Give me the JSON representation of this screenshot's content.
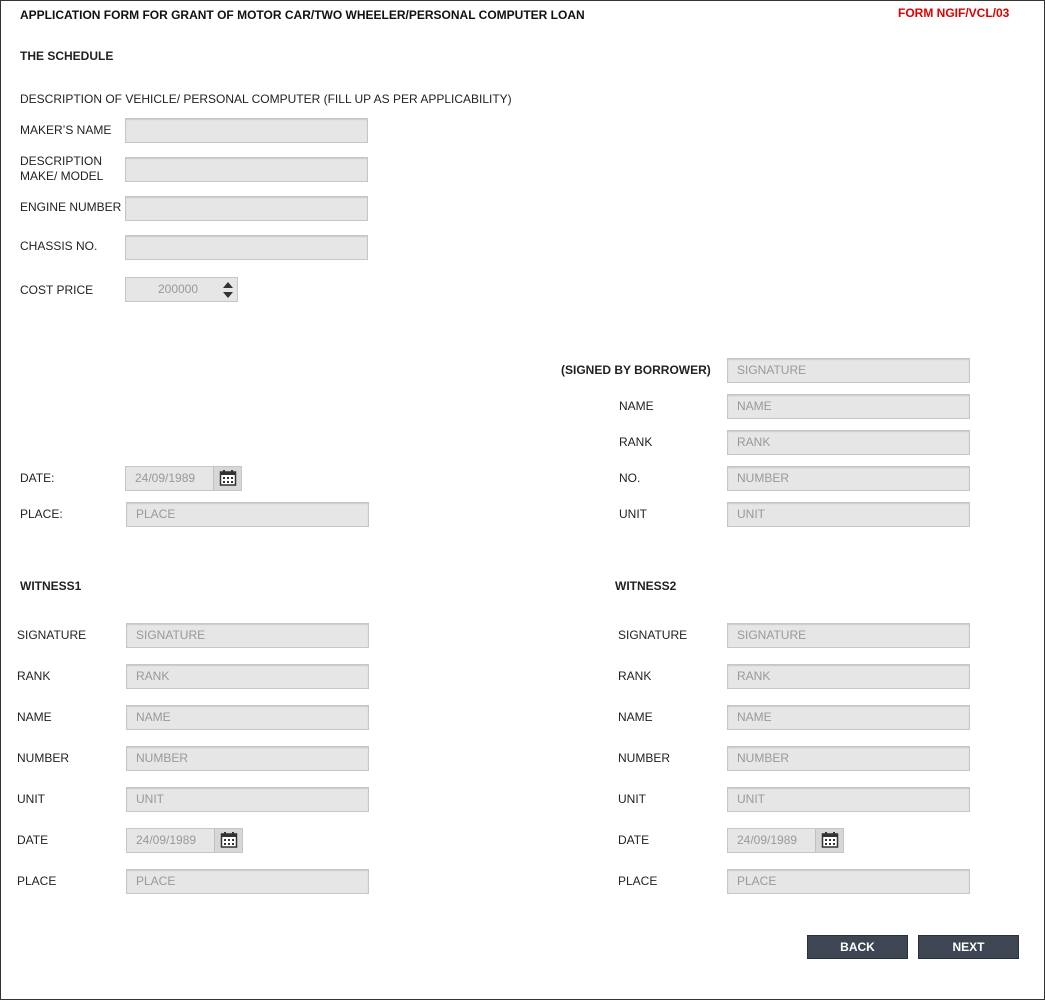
{
  "header": {
    "title": "APPLICATION FORM FOR GRANT OF MOTOR CAR/TWO WHEELER/PERSONAL COMPUTER LOAN",
    "form_code": "FORM NGIF/VCL/03"
  },
  "schedule": {
    "heading": "THE SCHEDULE",
    "description": "DESCRIPTION OF VEHICLE/ PERSONAL COMPUTER (FILL UP AS PER APPLICABILITY)",
    "maker_label": "MAKER’S NAME",
    "maker_value": "",
    "description_label_line1": "DESCRIPTION",
    "description_label_line2": "MAKE/ MODEL",
    "description_value": "",
    "engine_label": "ENGINE NUMBER",
    "engine_value": "",
    "chassis_label": "CHASSIS NO.",
    "chassis_value": "",
    "cost_label": "COST PRICE",
    "cost_value": "200000"
  },
  "borrower": {
    "signed_label": "(SIGNED BY BORROWER)",
    "signature_placeholder": "SIGNATURE",
    "name_label": "NAME",
    "name_placeholder": "NAME",
    "rank_label": "RANK",
    "rank_placeholder": "RANK",
    "no_label": "NO.",
    "no_placeholder": "NUMBER",
    "unit_label": "UNIT",
    "unit_placeholder": "UNIT",
    "date_label": "DATE:",
    "date_value": "24/09/1989",
    "place_label": "PLACE:",
    "place_placeholder": "PLACE"
  },
  "witness1": {
    "heading": "WITNESS1",
    "signature_label": "SIGNATURE",
    "signature_placeholder": "SIGNATURE",
    "rank_label": "RANK",
    "rank_placeholder": "RANK",
    "name_label": "NAME",
    "name_placeholder": "NAME",
    "number_label": "NUMBER",
    "number_placeholder": "NUMBER",
    "unit_label": "UNIT",
    "unit_placeholder": "UNIT",
    "date_label": "DATE",
    "date_value": "24/09/1989",
    "place_label": "PLACE",
    "place_placeholder": "PLACE"
  },
  "witness2": {
    "heading": "WITNESS2",
    "signature_label": "SIGNATURE",
    "signature_placeholder": "SIGNATURE",
    "rank_label": "RANK",
    "rank_placeholder": "RANK",
    "name_label": "NAME",
    "name_placeholder": "NAME",
    "number_label": "NUMBER",
    "number_placeholder": "NUMBER",
    "unit_label": "UNIT",
    "unit_placeholder": "UNIT",
    "date_label": "DATE",
    "date_value": "24/09/1989",
    "place_label": "PLACE",
    "place_placeholder": "PLACE"
  },
  "actions": {
    "back_label": "BACK",
    "next_label": "NEXT"
  },
  "icons": {
    "date_picker": "calendar-icon",
    "stepper": "spinner-arrows-icon"
  },
  "colors": {
    "form_code": "#e00000",
    "button": "#3d4652"
  }
}
